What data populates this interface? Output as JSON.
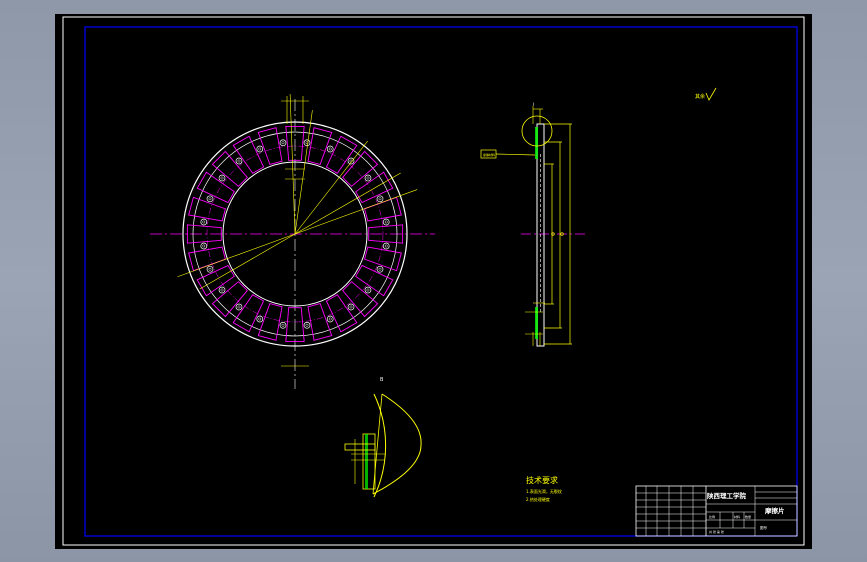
{
  "colors": {
    "background": "#000000",
    "border": "#ffffff",
    "frame": "#0000ff",
    "outline": "#ffffff",
    "slot": "#ff00ff",
    "center_line": "#ff00ff",
    "dimension": "#ffff00",
    "leader": "#ffff00",
    "hatch": "#00ff00"
  },
  "drawing": {
    "section_label": "B",
    "roughness_label": "其余",
    "leader_label": "摩擦材料",
    "detail_label": "I"
  },
  "tech_requirements": {
    "title": "技术要求",
    "lines": [
      "1.表面光滑，无裂纹",
      "2.热处理硬度"
    ]
  },
  "title_block": {
    "school": "陕西理工学院",
    "part_name": "摩擦片",
    "drawing_no": "图号",
    "scale": "比例",
    "material": "材料",
    "quantity": "数量",
    "sheet": "共 张 第 张"
  }
}
